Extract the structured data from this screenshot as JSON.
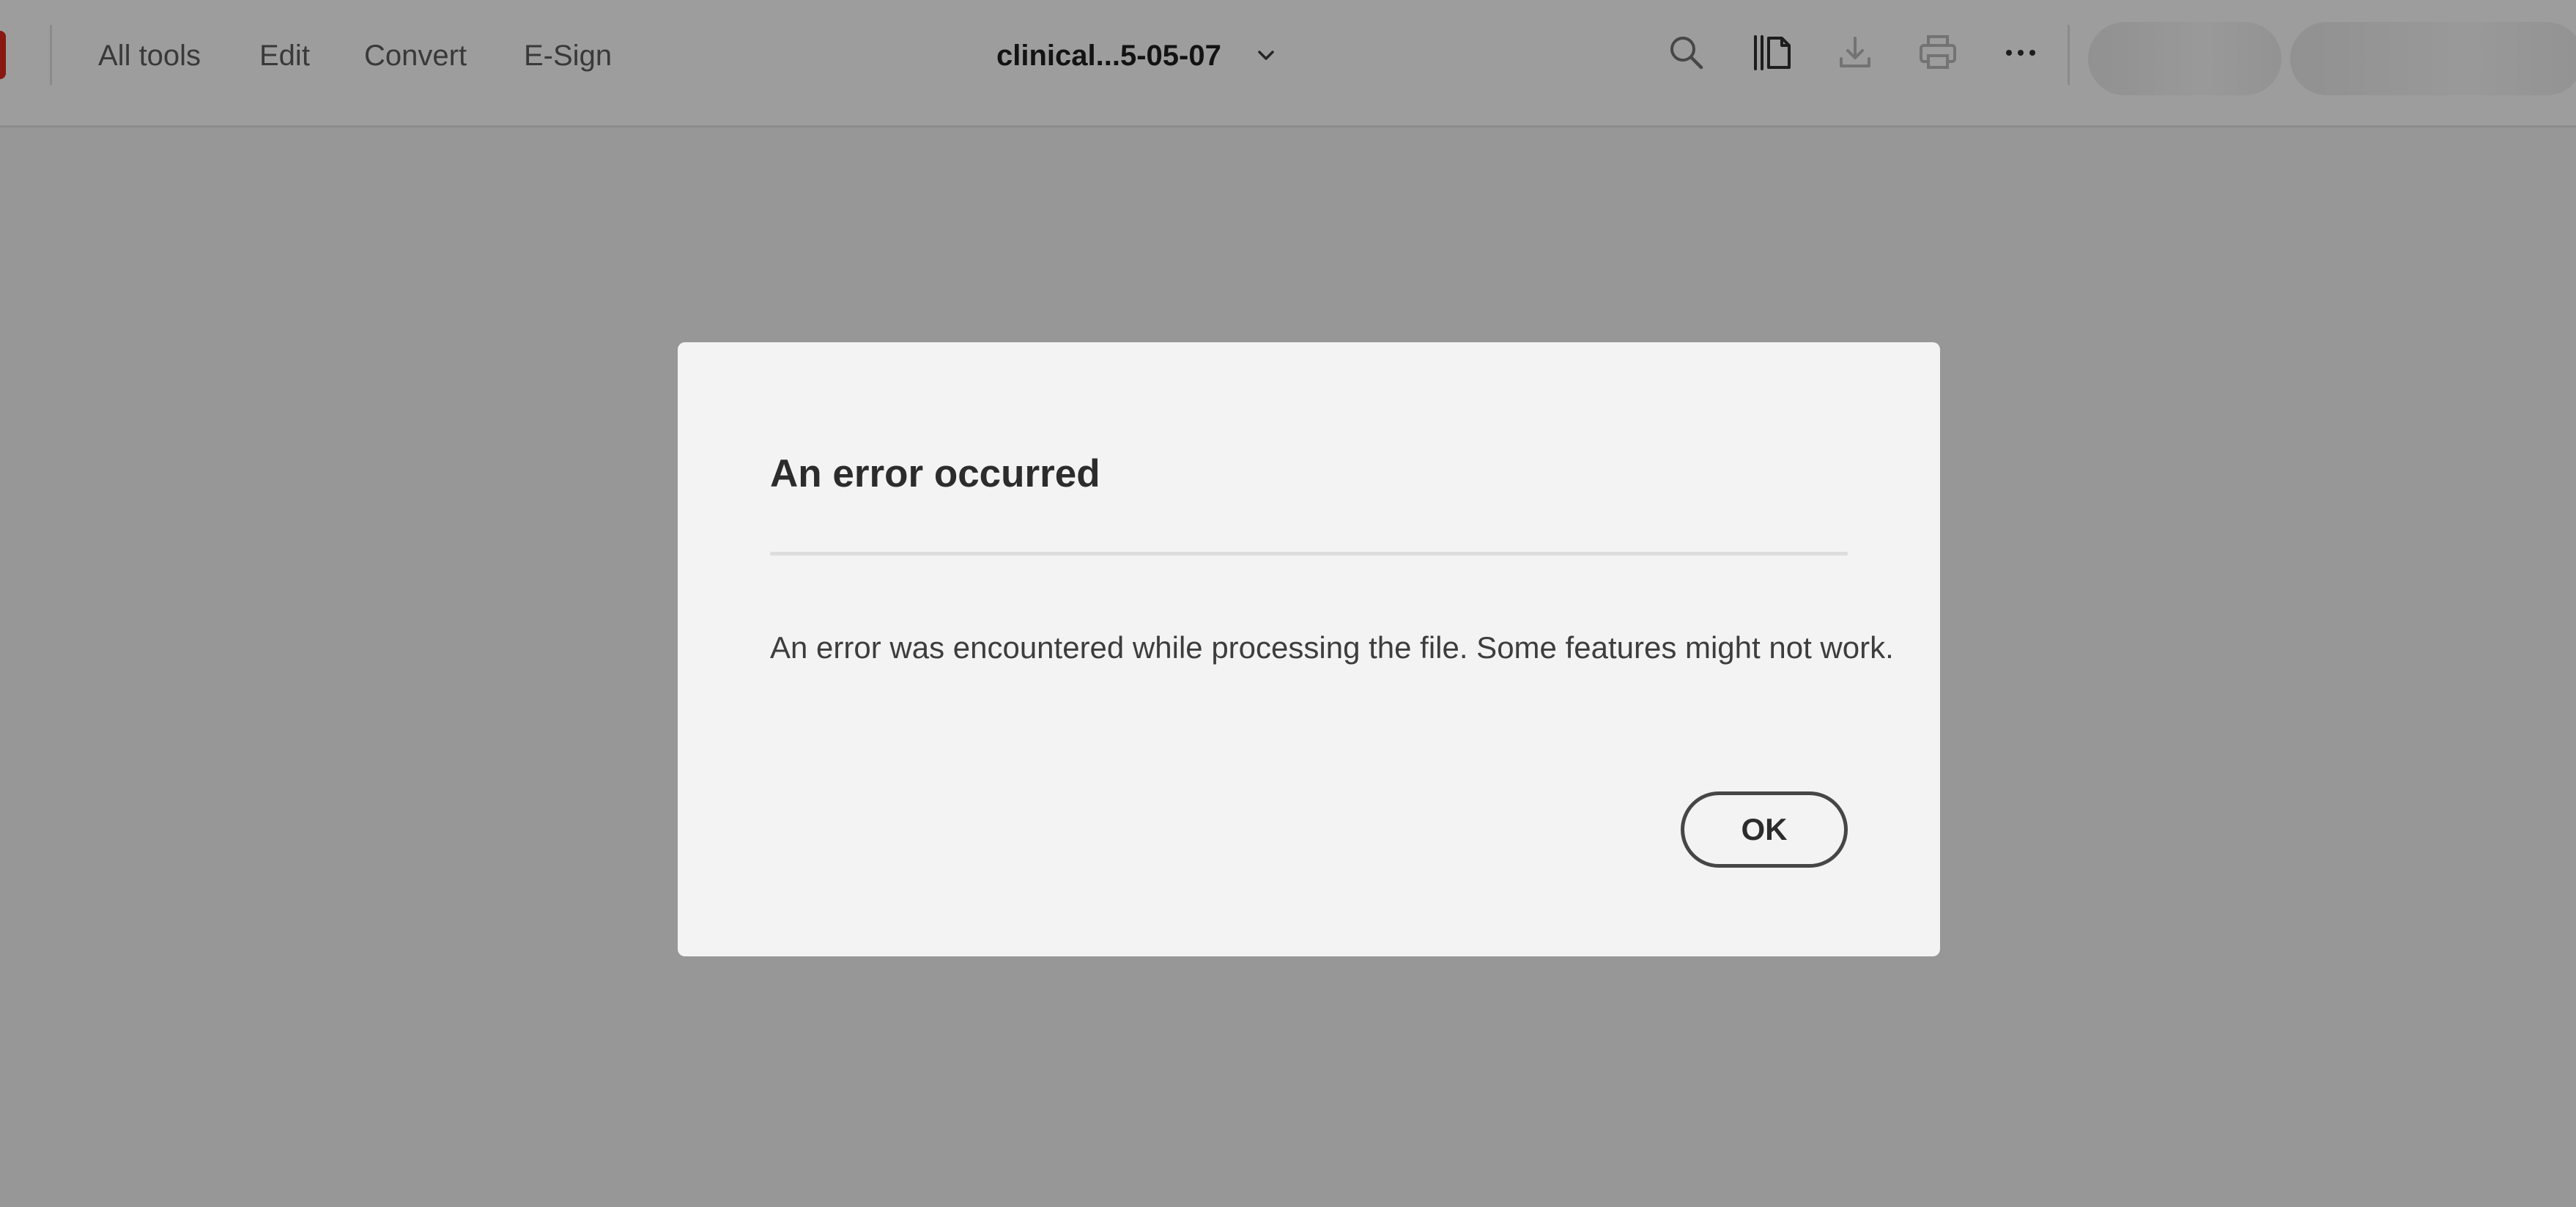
{
  "toolbar": {
    "nav": [
      "All tools",
      "Edit",
      "Convert",
      "E-Sign"
    ],
    "document_title": "clinical...5-05-07",
    "icons": [
      "search-icon",
      "page-thumbnails-icon",
      "download-icon",
      "print-icon",
      "more-options-icon"
    ]
  },
  "dialog": {
    "title": "An error occurred",
    "message": "An error was encountered while processing the file. Some features might not work.",
    "ok_label": "OK"
  },
  "colors": {
    "overlay": "rgba(0,0,0,0.36)",
    "dialog_bg": "#f3f3f3",
    "brand_red": "#d7261d",
    "toolbar_bg": "#f6f6f6"
  }
}
